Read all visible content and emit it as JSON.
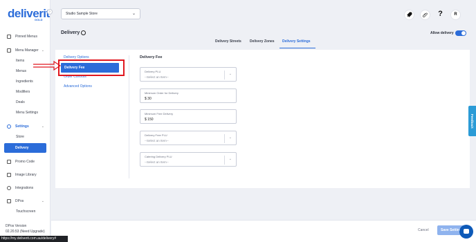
{
  "app": {
    "logo": "deliverit",
    "logo_sub": "GOLD",
    "collapse_icon": "chevron-right-icon"
  },
  "sidebar": {
    "items": [
      {
        "label": "Pinned Menus",
        "icon": "pin-icon"
      },
      {
        "label": "Menu Manager",
        "icon": "menu-icon",
        "expandable": true
      },
      {
        "label": "Items"
      },
      {
        "label": "Menus"
      },
      {
        "label": "Ingredients"
      },
      {
        "label": "Modifiers"
      },
      {
        "label": "Deals"
      },
      {
        "label": "Menu Settings"
      },
      {
        "label": "Settings",
        "icon": "settings-icon",
        "expandable": true
      },
      {
        "label": "Store"
      },
      {
        "label": "Delivery",
        "active": true
      },
      {
        "label": "Promo Code",
        "icon": "promo-icon"
      },
      {
        "label": "Image Library",
        "icon": "image-icon"
      },
      {
        "label": "Integrations",
        "icon": "integrations-icon"
      },
      {
        "label": "DPos",
        "icon": "pos-icon",
        "expandable": true
      },
      {
        "label": "Touchscreen"
      }
    ],
    "version_title": "DPos Version",
    "version_value": "02.20.53 (Need Upgrade)"
  },
  "topbar": {
    "store_select": "Studio Sample Store",
    "user_initial": "R",
    "help_glyph": "?",
    "icons": [
      "rocket-icon",
      "attachment-icon",
      "help-icon",
      "user-avatar"
    ]
  },
  "header": {
    "title": "Delivery",
    "allow_label": "Allow delivery",
    "allow_on": true
  },
  "tabs": [
    {
      "label": "Delivery Streets"
    },
    {
      "label": "Delivery Zones"
    },
    {
      "label": "Delivery Settings",
      "active": true
    }
  ],
  "left_nav": {
    "items": [
      "Delivery Options",
      "Delivery Fee",
      "Order Controls",
      "Advanced Options"
    ],
    "active": "Delivery Fee"
  },
  "section": {
    "title": "Delivery Fee",
    "fields": [
      {
        "label": "Delivery PLU",
        "value": "--Select an Item--",
        "type": "select"
      },
      {
        "label": "Minimum Order for Delivery",
        "value": "$  30",
        "type": "input"
      },
      {
        "label": "Minimum Free Delivery",
        "value": "$  150",
        "type": "input"
      },
      {
        "label": "Delivery Free PLU",
        "value": "--Select an Item--",
        "type": "select"
      },
      {
        "label": "Catering Delivery PLU",
        "value": "--Select an Item--",
        "type": "select"
      }
    ]
  },
  "footer": {
    "cancel_label": "Cancel",
    "save_label": "Save Settings"
  },
  "feedback_label": "Feedback",
  "status_url": "https://my.deliverit.com.au/delivery#",
  "colors": {
    "accent": "#2b6cd9",
    "annotation": "#e0161e",
    "feedback": "#2b9bd6"
  }
}
